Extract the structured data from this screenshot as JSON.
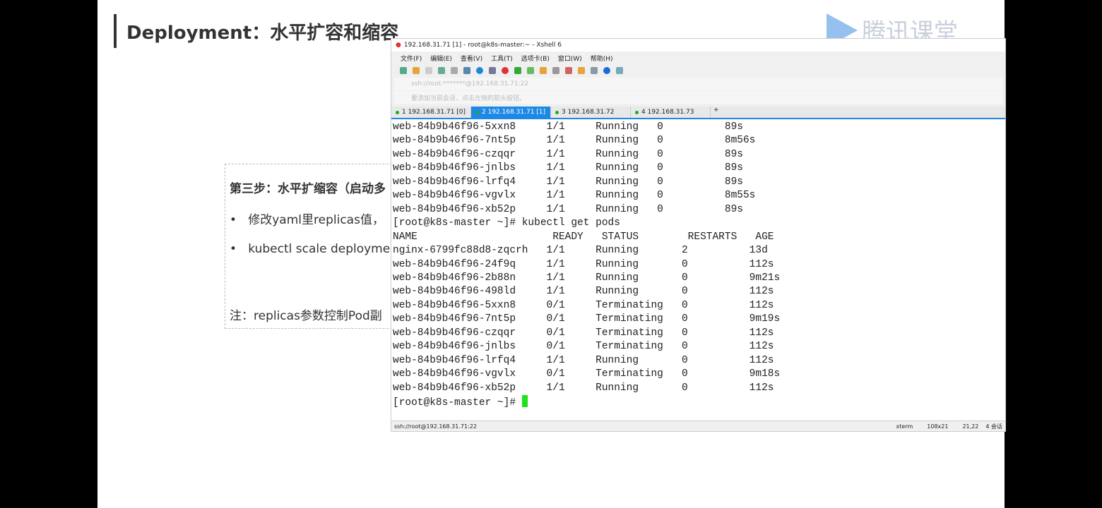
{
  "slide": {
    "title": "Deployment：水平扩容和缩容",
    "logo": "腾讯课堂",
    "step": "第三步：水平扩缩容（启动多",
    "bullet1": "修改yaml里replicas值，",
    "bullet2": "kubectl scale deployme",
    "note": "注：replicas参数控制Pod副"
  },
  "xshell": {
    "title": "192.168.31.71 [1] - root@k8s-master:~ - Xshell 6",
    "menu": [
      "文件(F)",
      "编辑(E)",
      "查看(V)",
      "工具(T)",
      "选项卡(B)",
      "窗口(W)",
      "帮助(H)"
    ],
    "address": "ssh://root:*******@192.168.31.71:22",
    "hint": "要添加当前会话，点击左侧的箭头按钮。",
    "tabs": [
      "1 192.168.31.71 [0]",
      "2 192.168.31.71 [1]",
      "3 192.168.31.72",
      "4 192.168.31.73"
    ],
    "active_tab": 1,
    "terminal": [
      "web-84b9b46f96-5xxn8     1/1     Running   0          89s",
      "web-84b9b46f96-7nt5p     1/1     Running   0          8m56s",
      "web-84b9b46f96-czqqr     1/1     Running   0          89s",
      "web-84b9b46f96-jnlbs     1/1     Running   0          89s",
      "web-84b9b46f96-lrfq4     1/1     Running   0          89s",
      "web-84b9b46f96-vgvlx     1/1     Running   0          8m55s",
      "web-84b9b46f96-xb52p     1/1     Running   0          89s",
      "[root@k8s-master ~]# kubectl get pods",
      "NAME                      READY   STATUS        RESTARTS   AGE",
      "nginx-6799fc88d8-zqcrh   1/1     Running       2          13d",
      "web-84b9b46f96-24f9q     1/1     Running       0          112s",
      "web-84b9b46f96-2b88n     1/1     Running       0          9m21s",
      "web-84b9b46f96-498ld     1/1     Running       0          112s",
      "web-84b9b46f96-5xxn8     0/1     Terminating   0          112s",
      "web-84b9b46f96-7nt5p     0/1     Terminating   0          9m19s",
      "web-84b9b46f96-czqqr     0/1     Terminating   0          112s",
      "web-84b9b46f96-jnlbs     0/1     Terminating   0          112s",
      "web-84b9b46f96-lrfq4     1/1     Running       0          112s",
      "web-84b9b46f96-vgvlx     0/1     Terminating   0          9m18s",
      "web-84b9b46f96-xb52p     1/1     Running       0          112s"
    ],
    "prompt": "[root@k8s-master ~]# ",
    "status": {
      "conn": "ssh://root@192.168.31.71:22",
      "term": "xterm",
      "size": "108x21",
      "pos": "21,22",
      "sessions": "4 会话"
    }
  }
}
